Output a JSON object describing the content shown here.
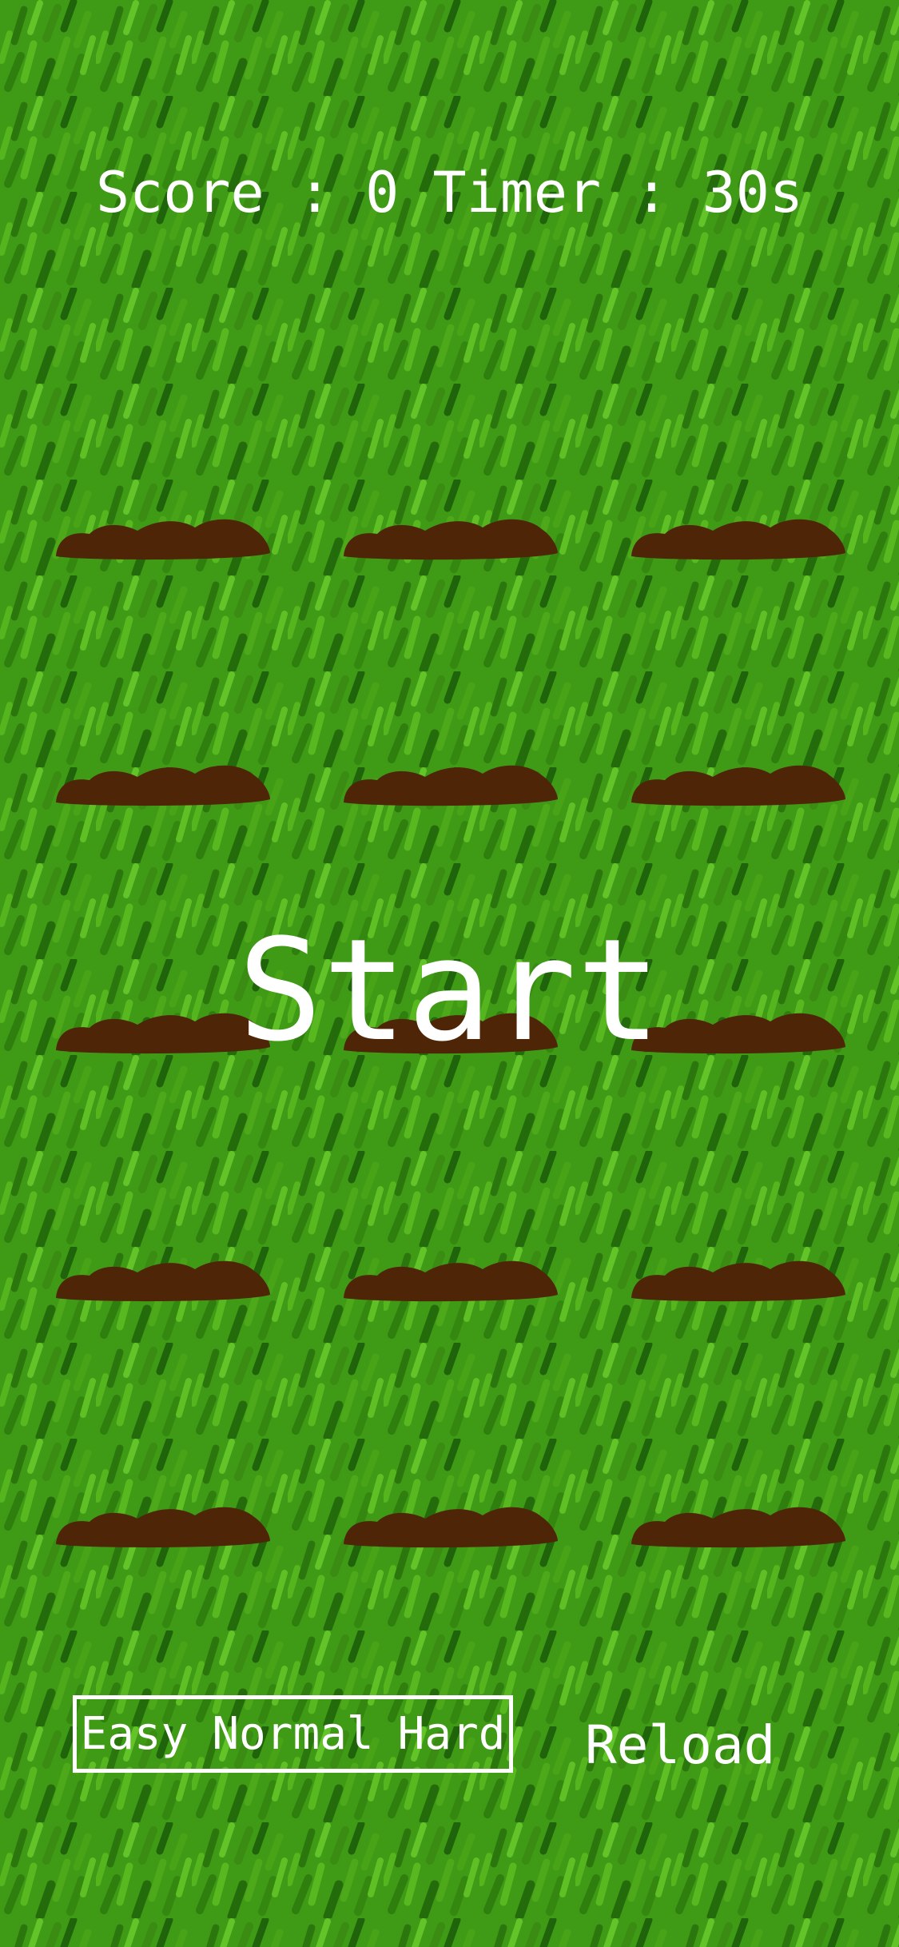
{
  "hud": {
    "score_label": "Score",
    "separator": ":",
    "score_value": "0",
    "timer_label": "Timer",
    "timer_value": "30s"
  },
  "start_label": "Start",
  "difficulty": {
    "options": [
      "Easy",
      "Normal",
      "Hard"
    ]
  },
  "reload_label": "Reload",
  "holes": {
    "rows": 5,
    "cols": 3
  },
  "colors": {
    "grass": "#3f9a16",
    "dirt": "#4f2508",
    "text": "#ffffff"
  }
}
